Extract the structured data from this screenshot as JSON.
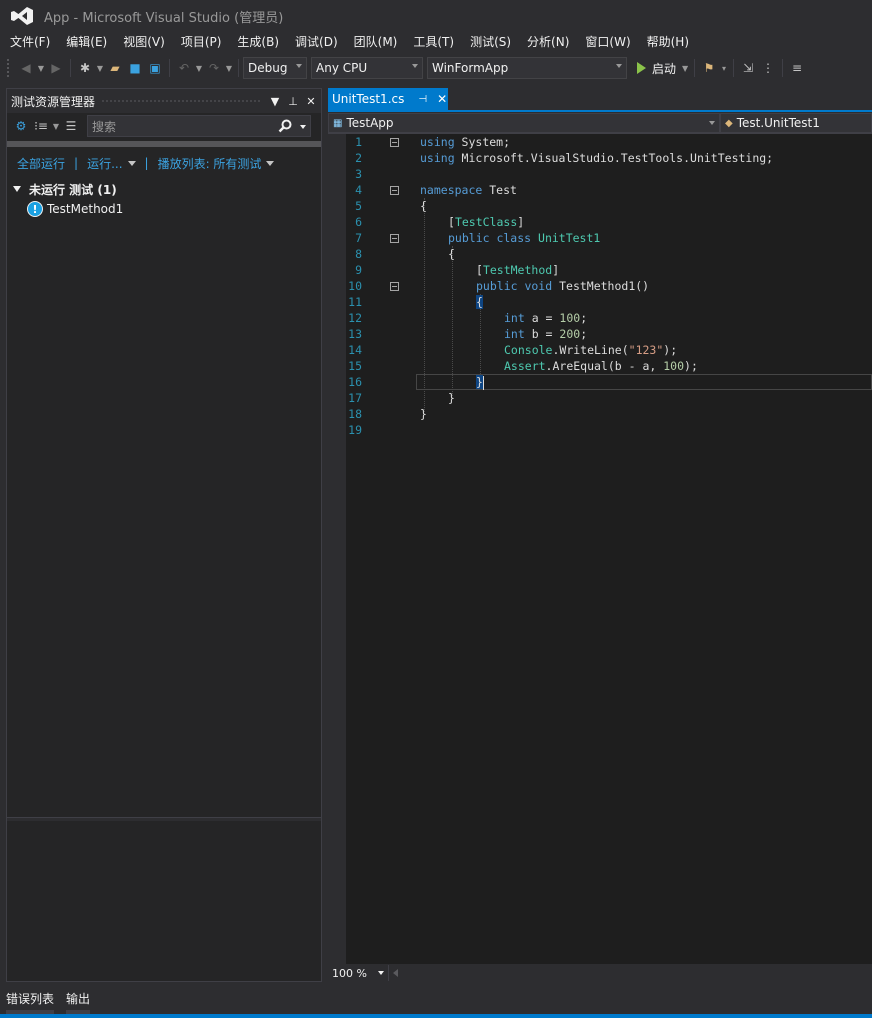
{
  "window": {
    "title": "App - Microsoft Visual Studio (管理员)"
  },
  "menu": [
    "文件(F)",
    "编辑(E)",
    "视图(V)",
    "项目(P)",
    "生成(B)",
    "调试(D)",
    "团队(M)",
    "工具(T)",
    "测试(S)",
    "分析(N)",
    "窗口(W)",
    "帮助(H)"
  ],
  "toolbar": {
    "config": "Debug",
    "platform": "Any CPU",
    "startup_project": "WinFormApp",
    "start_label": "启动"
  },
  "test_explorer": {
    "title": "测试资源管理器",
    "search_placeholder": "搜索",
    "run_all": "全部运行",
    "run": "运行...",
    "playlist": "播放列表: 所有测试",
    "group_label": "未运行 测试 (1)",
    "tests": [
      "TestMethod1"
    ]
  },
  "editor": {
    "tab_label": "UnitTest1.cs",
    "nav_project": "TestApp",
    "nav_class": "Test.UnitTest1",
    "zoom": "100 %",
    "line_numbers": [
      "1",
      "2",
      "3",
      "4",
      "5",
      "6",
      "7",
      "8",
      "9",
      "10",
      "11",
      "12",
      "13",
      "14",
      "15",
      "16",
      "17",
      "18",
      "19"
    ],
    "code": {
      "l1_kw": "using",
      "l1_rest": " System;",
      "l2_kw": "using",
      "l2_rest": " Microsoft.VisualStudio.TestTools.UnitTesting;",
      "l4_kw": "namespace",
      "l4_rest": " Test",
      "l5": "{",
      "l6_attr": "TestClass",
      "l7_kw": "public class",
      "l7_rest": " UnitTest1",
      "l8": "{",
      "l9_attr": "TestMethod",
      "l10_kw": "public void",
      "l10_rest": " TestMethod1()",
      "l11": "{",
      "l12_kw": "int",
      "l12_rest": " a = ",
      "l12_num": "100",
      "l12_end": ";",
      "l13_kw": "int",
      "l13_rest": " b = ",
      "l13_num": "200",
      "l13_end": ";",
      "l14_type": "Console",
      "l14_rest": ".WriteLine(",
      "l14_str": "\"123\"",
      "l14_end": ");",
      "l15_type": "Assert",
      "l15_rest": ".AreEqual(b - a, ",
      "l15_num": "100",
      "l15_end": ");",
      "l16": "}",
      "l17": "}",
      "l18": "}"
    }
  },
  "bottom_tabs": [
    "错误列表",
    "输出"
  ],
  "colors": {
    "accent": "#007acc",
    "link": "#3ba2e0",
    "keyword": "#569cd6",
    "type": "#4ec9b0"
  }
}
